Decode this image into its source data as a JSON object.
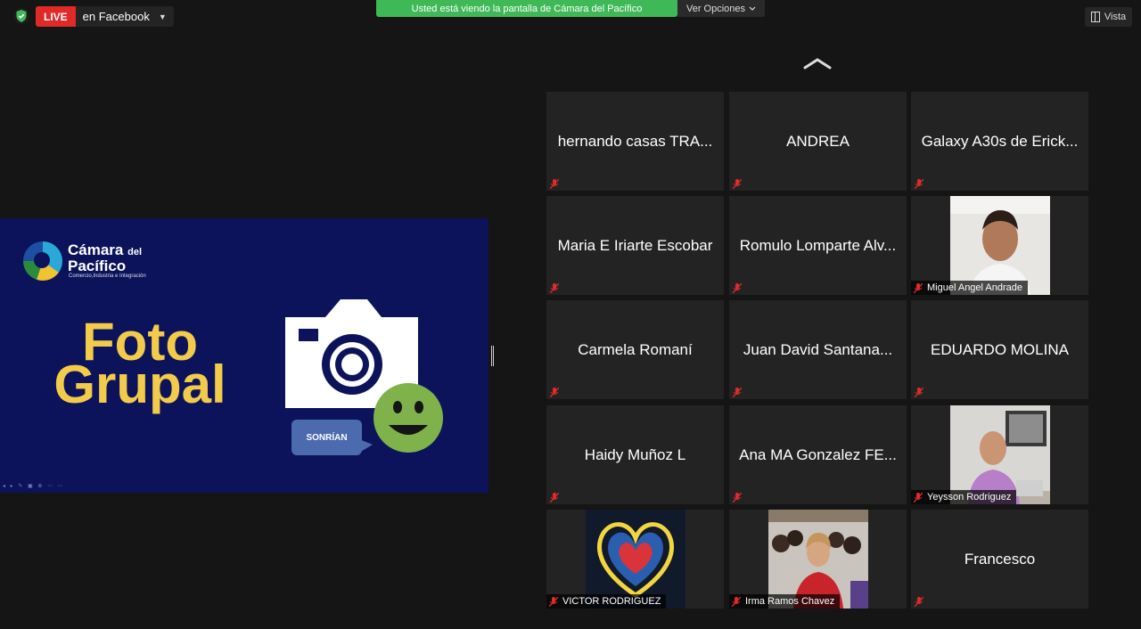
{
  "topbar": {
    "live_badge": "LIVE",
    "live_destination": "en Facebook",
    "viewing_banner": "Usted está viendo la pantalla de Cámara del Pacífico",
    "view_options": "Ver Opciones",
    "view_button": "Vista"
  },
  "slide": {
    "logo_line1": "Cámara",
    "logo_line1b": "del",
    "logo_line2": "Pacífico",
    "logo_subtitle": "Comercio,Industria e Integración",
    "title_line1": "Foto",
    "title_line2": "Grupal",
    "bubble_text": "SONRÍAN"
  },
  "participants": [
    {
      "name": "hernando casas TRA...",
      "muted": true,
      "video": false
    },
    {
      "name": "ANDREA",
      "muted": true,
      "video": false
    },
    {
      "name": "Galaxy A30s de Erick...",
      "muted": true,
      "video": false
    },
    {
      "name": "Maria E Iriarte Escobar",
      "muted": true,
      "video": false
    },
    {
      "name": "Romulo Lomparte Alv...",
      "muted": true,
      "video": false
    },
    {
      "name": "Miguel Angel Andrade",
      "muted": true,
      "video": true
    },
    {
      "name": "Carmela Romaní",
      "muted": true,
      "video": false
    },
    {
      "name": "Juan David Santana...",
      "muted": true,
      "video": false
    },
    {
      "name": "EDUARDO MOLINA",
      "muted": true,
      "video": false
    },
    {
      "name": "Haidy Muñoz L",
      "muted": true,
      "video": false
    },
    {
      "name": "Ana MA Gonzalez FE...",
      "muted": true,
      "video": false
    },
    {
      "name": "Yeysson Rodriguez",
      "muted": true,
      "video": true
    },
    {
      "name": "VICTOR RODRIGUEZ",
      "muted": true,
      "video": true
    },
    {
      "name": "Irma Ramos Chavez",
      "muted": true,
      "video": true
    },
    {
      "name": "Francesco",
      "muted": true,
      "video": false
    }
  ],
  "colors": {
    "live": "#e02a2a",
    "banner": "#3fb957",
    "slide_bg": "#0c135a",
    "title": "#f3cb4b",
    "mic_muted": "#e02a2a"
  }
}
